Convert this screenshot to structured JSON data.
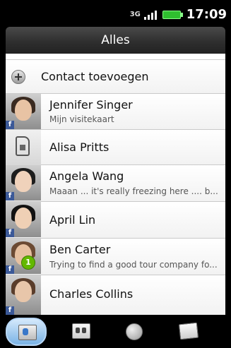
{
  "status_bar": {
    "network_label": "3G",
    "time": "17:09",
    "battery_color": "#2fbf2f"
  },
  "header": {
    "title": "Alles"
  },
  "add_contact": {
    "label": "Contact toevoegen",
    "icon": "plus-circle-icon"
  },
  "contacts": [
    {
      "name": "Jennifer Singer",
      "subtitle": "Mijn visitekaart",
      "avatar": "photo",
      "source_badge": "f"
    },
    {
      "name": "Alisa Pritts",
      "subtitle": "",
      "avatar": "sim-card-icon"
    },
    {
      "name": "Angela Wang",
      "subtitle": "Maaan ... it's really freezing here .... b...",
      "avatar": "photo",
      "source_badge": "f"
    },
    {
      "name": "April  Lin",
      "subtitle": "",
      "avatar": "photo",
      "source_badge": "f"
    },
    {
      "name": "Ben  Carter",
      "subtitle": "Trying to find a good tour company fo...",
      "avatar": "photo",
      "source_badge": "f",
      "notification_count": "1"
    },
    {
      "name": "Charles  Collins",
      "subtitle": "",
      "avatar": "photo",
      "source_badge": "f"
    }
  ],
  "tabs": [
    {
      "name": "contacts-tab",
      "icon": "contact-card-icon",
      "active": true
    },
    {
      "name": "groups-tab",
      "icon": "group-card-icon",
      "active": false
    },
    {
      "name": "online-directories-tab",
      "icon": "globe-icon",
      "active": false
    },
    {
      "name": "call-history-tab",
      "icon": "call-log-icon",
      "active": false
    }
  ],
  "colors": {
    "active_tab": "#7ab3e5",
    "facebook": "#3b5998",
    "badge": "#63b800"
  }
}
